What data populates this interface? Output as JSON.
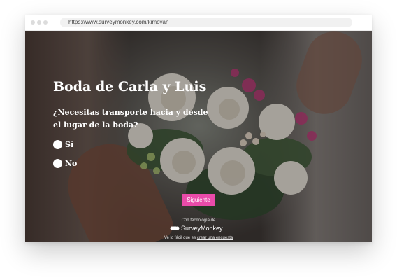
{
  "browser": {
    "url": "https://www.surveymonkey.com/kimovan"
  },
  "survey": {
    "title": "Boda de Carla y Luis",
    "question": "¿Necesitas transporte hacia y desde el lugar de la boda?",
    "options": [
      {
        "label": "Sí",
        "selected": false
      },
      {
        "label": "No",
        "selected": false
      }
    ],
    "next_button_label": "Siguiente"
  },
  "footer": {
    "powered_by": "Con tecnología de",
    "brand_name": "SurveyMonkey",
    "tagline_prefix": "Ve lo fácil que es",
    "tagline_link": "crear una encuesta"
  },
  "colors": {
    "accent": "#e94ba9",
    "text_on_image": "#ffffff"
  },
  "icons": {
    "brand": "surveymonkey-logo-icon"
  }
}
